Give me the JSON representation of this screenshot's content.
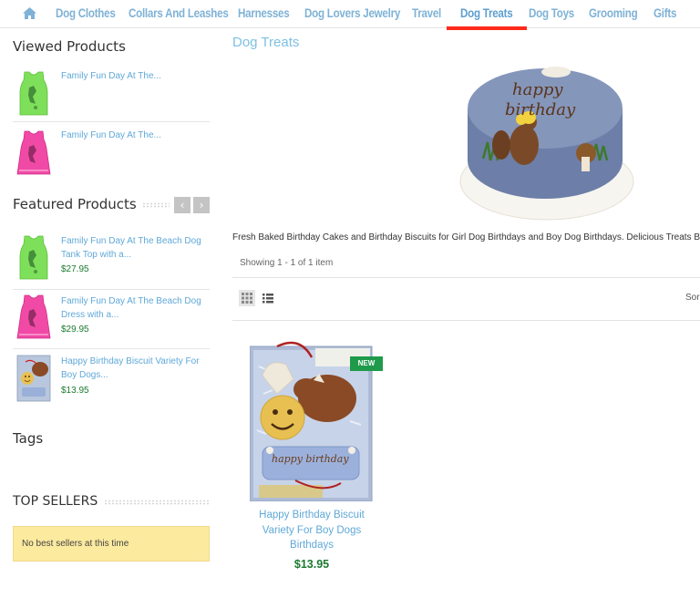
{
  "nav": {
    "items": [
      {
        "label": "Dog Clothes"
      },
      {
        "label": "Collars And Leashes"
      },
      {
        "label": "Harnesses"
      },
      {
        "label": "Dog Lovers Jewelry"
      },
      {
        "label": "Travel"
      },
      {
        "label": "Dog Treats"
      },
      {
        "label": "Dog Toys"
      },
      {
        "label": "Grooming"
      },
      {
        "label": "Gifts"
      }
    ],
    "active": "Dog Treats",
    "link_color": "#7fb2d6",
    "active_underline_color": "#ff2a1a"
  },
  "sidebar": {
    "viewed": {
      "title": "Viewed Products",
      "items": [
        {
          "name": "Family Fun Day At The...",
          "thumb": "green-dog-tank-top"
        },
        {
          "name": "Family Fun Day At The...",
          "thumb": "pink-dog-dress"
        }
      ]
    },
    "featured": {
      "title": "Featured Products",
      "items": [
        {
          "name_line1": "Family Fun Day At The Beach Dog",
          "name_line2": "Tank Top with a...",
          "price": "$27.95",
          "thumb": "green-dog-tank-top"
        },
        {
          "name_line1": "Family Fun Day At The Beach Dog",
          "name_line2": "Dress with a...",
          "price": "$29.95",
          "thumb": "pink-dog-dress"
        },
        {
          "name_line1": "Happy Birthday Biscuit Variety For",
          "name_line2": "Boy Dogs...",
          "price": "$13.95",
          "thumb": "birthday-biscuit-box"
        }
      ],
      "prev_icon": "chevron-left-icon",
      "next_icon": "chevron-right-icon"
    },
    "tags": {
      "title": "Tags"
    },
    "top_sellers": {
      "title": "TOP SELLERS",
      "empty_text": "No best sellers at this time"
    }
  },
  "main": {
    "title": "Dog Treats",
    "category_image": "birthday-cake",
    "description": "Fresh Baked Birthday Cakes and Birthday Biscuits for Girl Dog Birthdays and Boy Dog Birthdays. Delicious Treats B",
    "showing": "Showing 1 - 1 of 1 item",
    "grid_icon": "grid-view-icon",
    "list_icon": "list-view-icon",
    "sort_label": "Sor",
    "products": [
      {
        "name_line1": "Happy Birthday Biscuit",
        "name_line2": "Variety For Boy Dogs",
        "name_line3": "Birthdays",
        "price": "$13.95",
        "badge": "NEW",
        "image_text": "happy birthday"
      }
    ]
  },
  "colors": {
    "link": "#5fa8d8",
    "price": "#1b7a2f",
    "badge": "#1f9a4b",
    "notice_bg": "#fcea9f"
  }
}
